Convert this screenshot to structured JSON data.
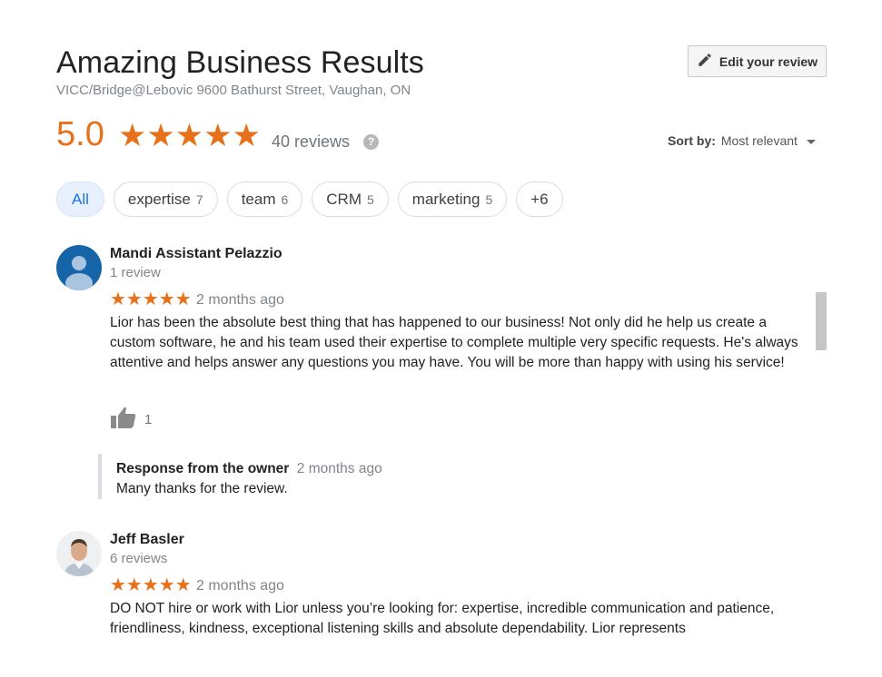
{
  "header": {
    "title": "Amazing Business Results",
    "address": "VICC/Bridge@Lebovic 9600 Bathurst Street, Vaughan, ON",
    "edit_review_label": "Edit your review"
  },
  "rating": {
    "value": "5.0",
    "stars": "★★★★★",
    "reviews_count_text": "40 reviews",
    "help_icon": "?"
  },
  "sort": {
    "label": "Sort by:",
    "value": "Most relevant"
  },
  "chips": [
    {
      "label": "All",
      "count": ""
    },
    {
      "label": "expertise",
      "count": "7"
    },
    {
      "label": "team",
      "count": "6"
    },
    {
      "label": "CRM",
      "count": "5"
    },
    {
      "label": "marketing",
      "count": "5"
    },
    {
      "label": "+6",
      "count": ""
    }
  ],
  "reviews": [
    {
      "name": "Mandi Assistant Pelazzio",
      "meta": "1 review",
      "stars": "★★★★★",
      "date": "2 months ago",
      "text": "Lior has been the absolute best thing that has happened to our business! Not only did he help us create a custom software, he and his team used their expertise to complete multiple very specific requests. He's always attentive and helps answer any questions you may have. You will be more than happy with using his service!",
      "likes": "1",
      "owner_response": {
        "label": "Response from the owner",
        "date": "2 months ago",
        "text": "Many thanks for the review."
      }
    },
    {
      "name": "Jeff Basler",
      "meta": "6 reviews",
      "stars": "★★★★★",
      "date": "2 months ago",
      "text": "DO NOT hire or work with Lior unless you’re looking for: expertise, incredible communication and patience, friendliness, kindness, exceptional listening skills and absolute dependability.  Lior represents"
    }
  ],
  "colors": {
    "accent_orange": "#e7711b",
    "chip_active_bg": "#e8f0fe",
    "chip_active_text": "#1a73e8",
    "muted_text": "#80868b"
  },
  "icons": {
    "edit": "pencil-icon",
    "help": "help-circle-icon",
    "sort_caret": "caret-down-icon",
    "like": "thumbs-up-icon",
    "avatar_default": "default-avatar-icon",
    "avatar_photo": "profile-photo"
  }
}
